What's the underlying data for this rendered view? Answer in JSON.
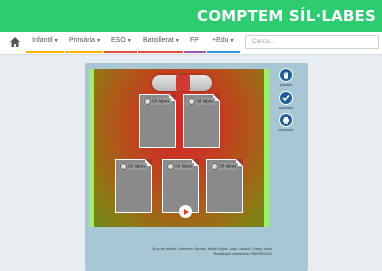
{
  "site": {
    "title": "COMPTEM SÍL·LABES"
  },
  "nav": {
    "items": [
      {
        "label": "Infantil",
        "bar_color": "#f4b400"
      },
      {
        "label": "Primària",
        "bar_color": "#f4b400"
      },
      {
        "label": "ESO",
        "bar_color": "#e74c3c"
      },
      {
        "label": "Batxillerat",
        "bar_color": "#e74c3c"
      },
      {
        "label": "FP",
        "bar_color": "#9b59b6"
      },
      {
        "label": "+Edu",
        "bar_color": "#3498db"
      }
    ],
    "search_placeholder": "Cerca..."
  },
  "activity": {
    "cards": [
      {
        "label": "Síl·labes"
      },
      {
        "label": "Síl·labes"
      },
      {
        "label": "Síl·labes"
      },
      {
        "label": "Síl·labes"
      },
      {
        "label": "Síl·labes"
      }
    ]
  },
  "sidebar": {
    "buttons": [
      {
        "caption": "practica"
      },
      {
        "caption": "avaluació"
      },
      {
        "caption": "imprimeix"
      }
    ]
  },
  "credits": {
    "line1": "Grup de treball: Domènec Garrido, Maria Pujals, Joan Galardi i Josep Vives",
    "line2": "Realització interactiva: PAVERDOLS"
  }
}
